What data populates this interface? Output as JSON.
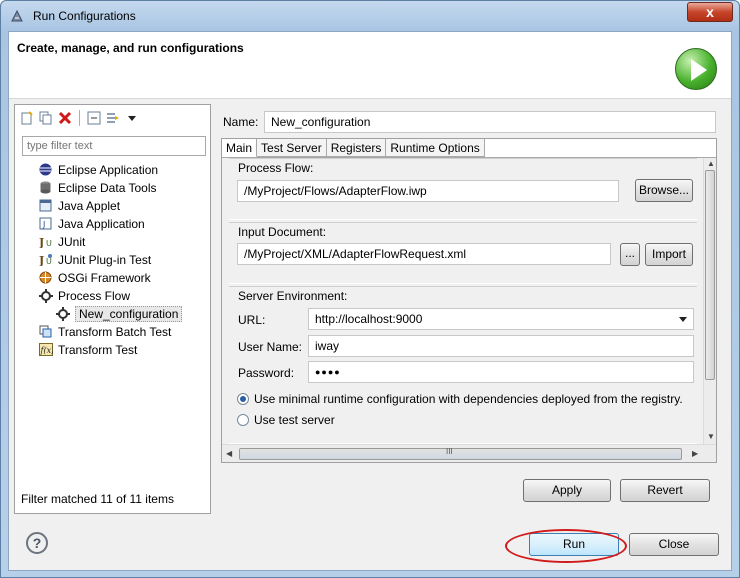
{
  "window": {
    "title": "Run Configurations",
    "close_symbol": "x"
  },
  "header": {
    "title": "Create, manage, and run configurations"
  },
  "left": {
    "filter_placeholder": "type filter text",
    "items": [
      {
        "label": "Eclipse Application",
        "icon": "eclipse-icon"
      },
      {
        "label": "Eclipse Data Tools",
        "icon": "database-icon"
      },
      {
        "label": "Java Applet",
        "icon": "applet-icon"
      },
      {
        "label": "Java Application",
        "icon": "java-app-icon"
      },
      {
        "label": "JUnit",
        "icon": "junit-icon"
      },
      {
        "label": "JUnit Plug-in Test",
        "icon": "junit-plugin-icon"
      },
      {
        "label": "OSGi Framework",
        "icon": "osgi-icon"
      },
      {
        "label": "Process Flow",
        "icon": "process-flow-icon"
      },
      {
        "label": "New_configuration",
        "icon": "process-flow-icon"
      },
      {
        "label": "Transform Batch Test",
        "icon": "transform-batch-icon"
      },
      {
        "label": "Transform Test",
        "icon": "function-icon"
      }
    ],
    "status": "Filter matched 11 of 11 items"
  },
  "config": {
    "name_label": "Name:",
    "name_value": "New_configuration",
    "tabs": [
      "Main",
      "Test Server",
      "Registers",
      "Runtime Options"
    ],
    "process_flow": {
      "label": "Process Flow:",
      "value": "/MyProject/Flows/AdapterFlow.iwp",
      "browse": "Browse..."
    },
    "input_document": {
      "label": "Input Document:",
      "value": "/MyProject/XML/AdapterFlowRequest.xml",
      "ellipsis": "...",
      "import": "Import"
    },
    "server_env": {
      "label": "Server Environment:",
      "url_label": "URL:",
      "url_value": "http://localhost:9000",
      "user_label": "User Name:",
      "user_value": "iway",
      "password_label": "Password:",
      "password_value": "●●●●",
      "radio1": "Use minimal runtime configuration with dependencies deployed from the registry.",
      "radio2": "Use test server"
    },
    "scroll_grip": "III"
  },
  "buttons": {
    "apply": "Apply",
    "revert": "Revert",
    "run": "Run",
    "close": "Close",
    "help": "?"
  },
  "colors": {
    "highlight": "#d11a1a",
    "run_accent": "#47b02c"
  }
}
